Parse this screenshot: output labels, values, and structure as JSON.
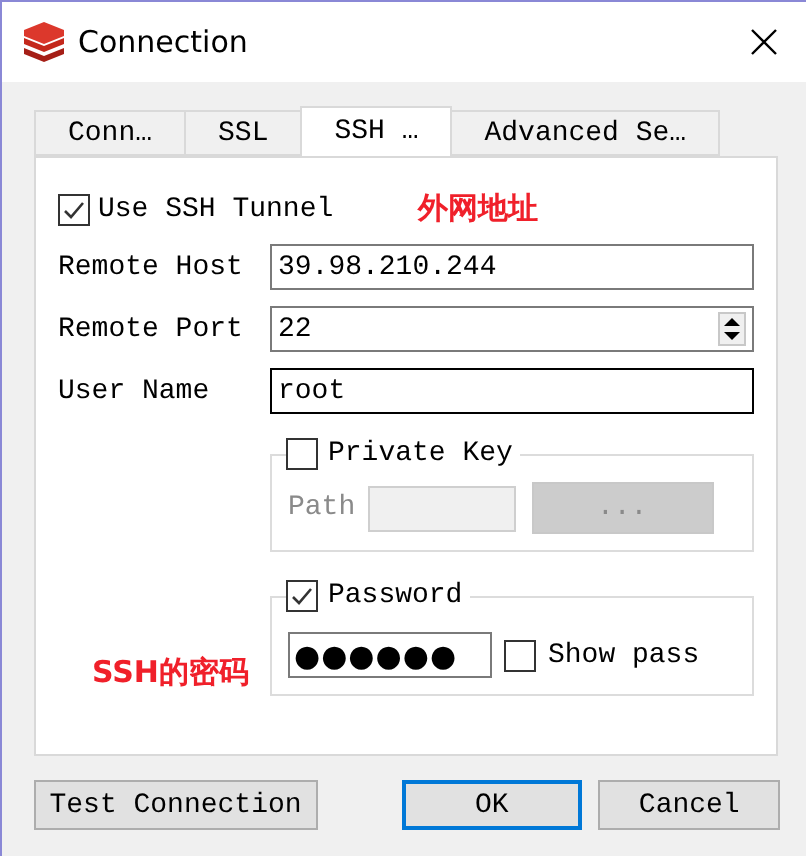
{
  "window": {
    "title": "Connection"
  },
  "tabs": [
    {
      "label": "Conn…",
      "selected": false
    },
    {
      "label": "SSL",
      "selected": false
    },
    {
      "label": "SSH …",
      "selected": true
    },
    {
      "label": "Advanced Se…",
      "selected": false
    }
  ],
  "use_tunnel": {
    "label": "Use SSH Tunnel",
    "checked": true
  },
  "host_annotation": "外网地址",
  "fields": [
    {
      "label": "Remote Host",
      "value": "39.98.210.244",
      "kind": "text",
      "focused": false
    },
    {
      "label": "Remote Port",
      "value": "22",
      "kind": "spin",
      "focused": false
    },
    {
      "label": "User Name",
      "value": "root",
      "kind": "text",
      "focused": true
    }
  ],
  "private_key": {
    "label": "Private Key",
    "checked": false,
    "disabled": true,
    "path_label": "Path",
    "browse_button": "..."
  },
  "password": {
    "label": "Password",
    "checked": true,
    "value": "●●●●●●",
    "show_pass": {
      "label": "Show pass",
      "checked": false
    }
  },
  "password_annotation": "SSH的密码",
  "buttons": [
    {
      "label": "Test Connection",
      "default": false
    },
    {
      "label": "OK",
      "default": true
    },
    {
      "label": "Cancel",
      "default": false
    }
  ]
}
